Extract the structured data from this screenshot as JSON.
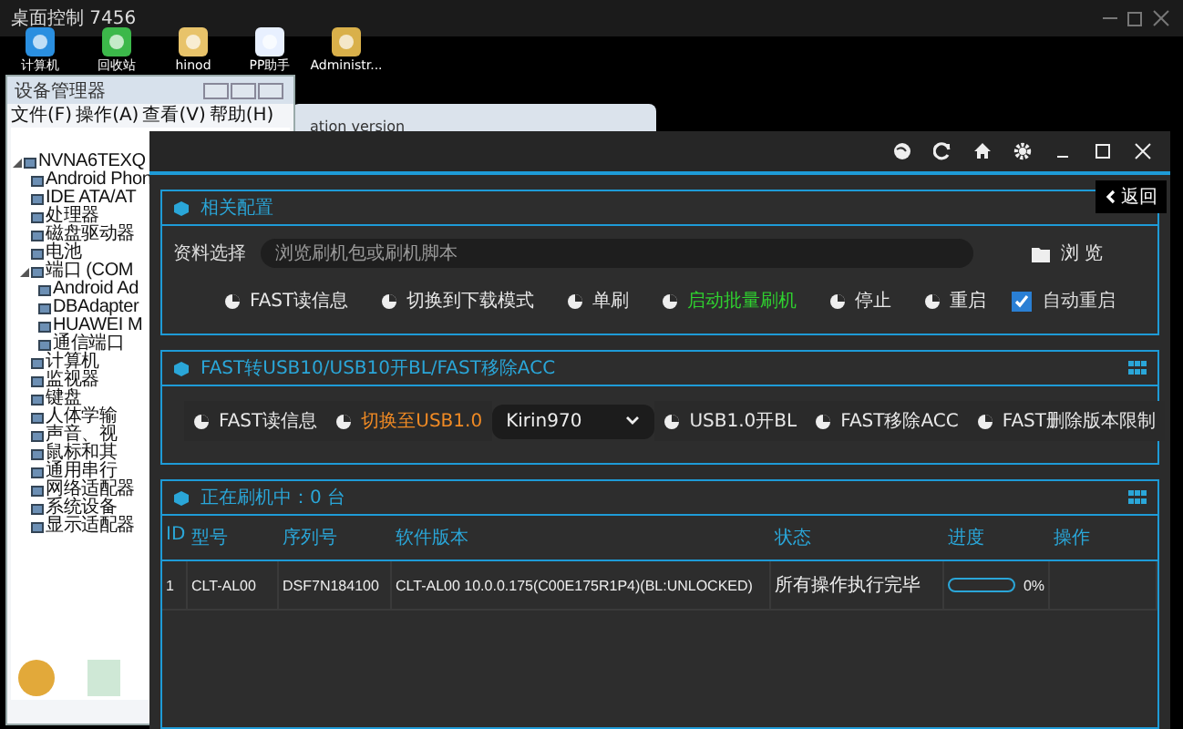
{
  "remote_bar": {
    "title": "桌面控制 7456"
  },
  "desktop_icons": [
    {
      "label": "计算机"
    },
    {
      "label": "回收站"
    },
    {
      "label": "hinod"
    },
    {
      "label": "PP助手"
    },
    {
      "label": "Administr..."
    }
  ],
  "back_window": {
    "title": "ation version"
  },
  "device_manager": {
    "title": "设备管理器",
    "menu": [
      "文件(F)",
      "操作(A)",
      "查看(V)",
      "帮助(H)"
    ],
    "tree": [
      {
        "label": "NVNA6TEXQ",
        "children": [
          {
            "label": "Android Phon"
          },
          {
            "label": "IDE ATA/AT"
          },
          {
            "label": "处理器"
          },
          {
            "label": "磁盘驱动器"
          },
          {
            "label": "电池"
          },
          {
            "label": "端口 (COM",
            "children": [
              {
                "label": "Android Ad"
              },
              {
                "label": "DBAdapter"
              },
              {
                "label": "HUAWEI M"
              },
              {
                "label": "通信端口"
              }
            ]
          },
          {
            "label": "计算机"
          },
          {
            "label": "监视器"
          },
          {
            "label": "键盘"
          },
          {
            "label": "人体学输"
          },
          {
            "label": "声音、视"
          },
          {
            "label": "鼠标和其"
          },
          {
            "label": "通用串行"
          },
          {
            "label": "网络适配器"
          },
          {
            "label": "系统设备"
          },
          {
            "label": "显示适配器"
          }
        ]
      }
    ]
  },
  "app": {
    "back_button": "返回",
    "config": {
      "title": "相关配置",
      "field_label": "资料选择",
      "placeholder": "浏览刷机包或刷机脚本",
      "browse": "浏 览",
      "buttons": [
        {
          "label": "FAST读信息",
          "color": "#e8e8e8"
        },
        {
          "label": "切换到下载模式",
          "color": "#e8e8e8"
        },
        {
          "label": "单刷",
          "color": "#e8e8e8"
        },
        {
          "label": "启动批量刷机",
          "color": "#2fd12f"
        },
        {
          "label": "停止",
          "color": "#e8e8e8"
        },
        {
          "label": "重启",
          "color": "#e8e8e8"
        }
      ],
      "auto_restart": {
        "label": "自动重启",
        "checked": true
      }
    },
    "fast": {
      "title": "FAST转USB10/USB10开BL/FAST移除ACC",
      "items": [
        {
          "kind": "button",
          "label": "FAST读信息",
          "color": "#e8e8e8"
        },
        {
          "kind": "button",
          "label": "切换至USB1.0",
          "color": "#f08a24"
        },
        {
          "kind": "select",
          "label": "Kirin970"
        },
        {
          "kind": "button",
          "label": "USB1.0开BL",
          "color": "#e8e8e8"
        },
        {
          "kind": "button",
          "label": "FAST移除ACC",
          "color": "#e8e8e8"
        },
        {
          "kind": "button",
          "label": "FAST删除版本限制",
          "color": "#e8e8e8"
        }
      ]
    },
    "devices": {
      "title": "正在刷机中：0 台",
      "columns": [
        "ID",
        "型号",
        "序列号",
        "软件版本",
        "状态",
        "进度",
        "操作"
      ],
      "rows": [
        {
          "id": "1",
          "model": "CLT-AL00",
          "serial": "DSF7N184100",
          "version": "CLT-AL00 10.0.0.175(C00E175R1P4)(BL:UNLOCKED)",
          "status": "所有操作执行完毕",
          "level": 0,
          "reading": "0%"
        }
      ]
    }
  }
}
